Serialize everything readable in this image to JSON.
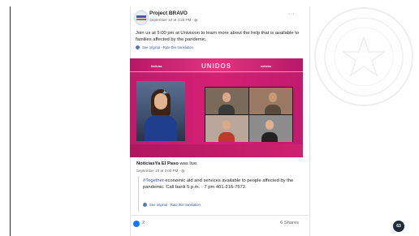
{
  "post": {
    "page_name": "Project BRAVO",
    "meta": "September 10 at 3:25 PM · ",
    "more": "···",
    "text": "Join us at 5:00 pm at Univision to learn more about the help that is available to families affected by the pandemic.",
    "see_original": "See original · Rate this translation"
  },
  "video": {
    "brand_left": "Noticias",
    "title": "UNIDOS",
    "brand_right": "noticias"
  },
  "shared": {
    "page_name": "NoticiasYa El Paso",
    "status_suffix": " was live.",
    "meta": "September 10 at 3:00 PM · ",
    "hashtag": "#Together",
    "text": " economic aid and services available to people affected by the pandemic. Call bank 5 p.m. - 7 pm 401-216-7572.",
    "see_original": "See original · Rate this translation"
  },
  "footer": {
    "reactions": "2",
    "shares": "6 Shares"
  },
  "slide_number": "63",
  "colors": {
    "video_pink": "#d51f74",
    "link_blue": "#385898",
    "like_blue": "#1877f2"
  }
}
